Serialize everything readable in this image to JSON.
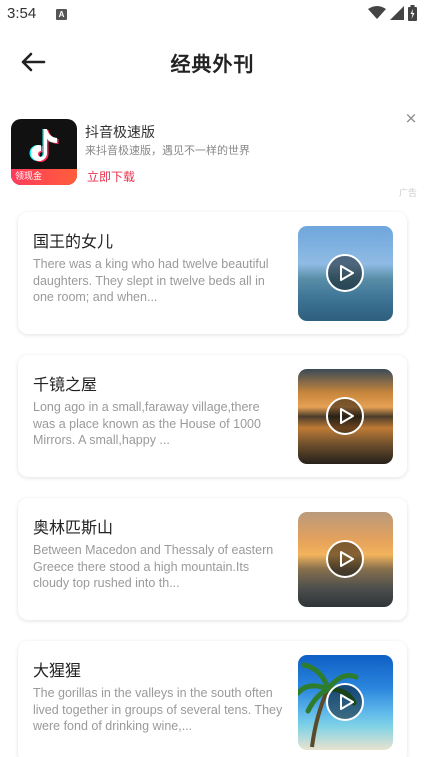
{
  "status": {
    "time": "3:54",
    "notification_icon": "A"
  },
  "header": {
    "title": "经典外刊"
  },
  "ad": {
    "app_name": "抖音极速版",
    "description": "来抖音极速版，遇见不一样的世界",
    "cta": "立即下载",
    "icon_strip": "领现金",
    "label": "广告",
    "close": "×"
  },
  "articles": [
    {
      "title": "国王的女儿",
      "excerpt": "There was a king who had twelve beautiful daughters. They slept in twelve beds all in one room; and when...",
      "thumb": "lake"
    },
    {
      "title": "千镜之屋",
      "excerpt": "Long ago in a small,faraway village,there was a place known as the House of 1000 Mirrors. A small,happy ...",
      "thumb": "mountain"
    },
    {
      "title": "奥林匹斯山",
      "excerpt": "Between Macedon and Thessaly of eastern Greece there stood a high mountain.Its cloudy top rushed into th...",
      "thumb": "sunset"
    },
    {
      "title": "大猩猩",
      "excerpt": "The gorillas in the valleys in the south often lived together in groups of several tens. They were fond of drinking wine,...",
      "thumb": "beach"
    }
  ],
  "colors": {
    "accent_red": "#e8344f",
    "text_primary": "#222222",
    "text_secondary": "#9a9a9a"
  }
}
